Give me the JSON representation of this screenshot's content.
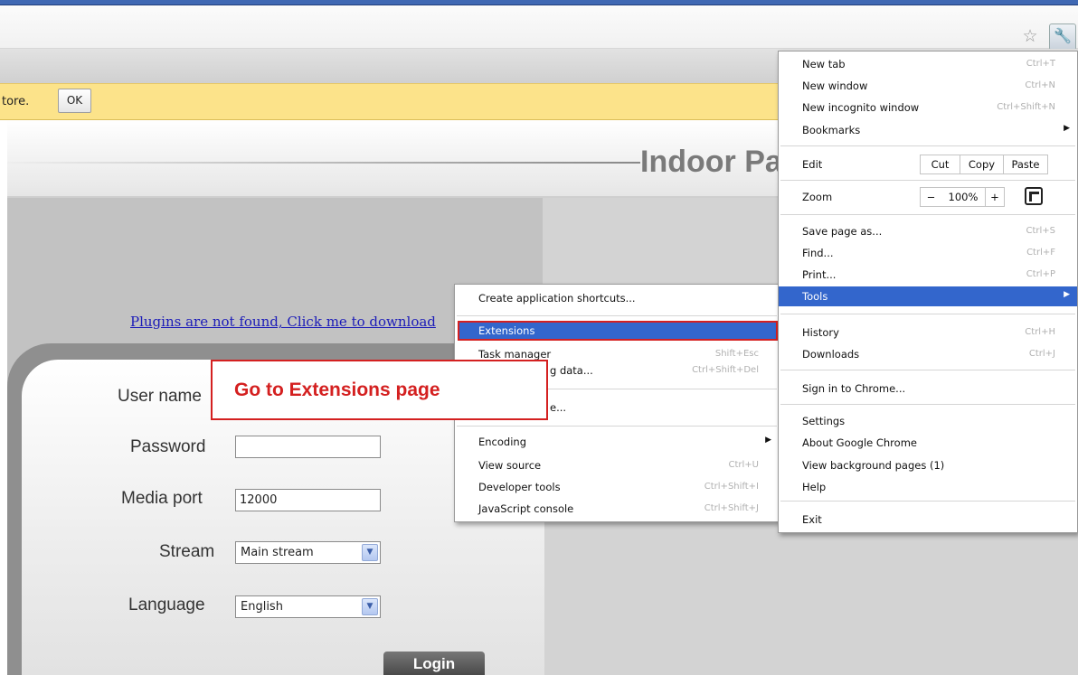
{
  "infobar": {
    "text": "tore.",
    "ok_label": "OK"
  },
  "toolbar": {
    "star_icon": "star-icon",
    "wrench_icon": "wrench-icon"
  },
  "page": {
    "title": "Indoor Pa",
    "plugin_link": "Plugins are not found, Click me to download",
    "login": {
      "username_label": "User name",
      "password_label": "Password",
      "password_value": "",
      "mediaport_label": "Media port",
      "mediaport_value": "12000",
      "stream_label": "Stream",
      "stream_value": "Main stream",
      "language_label": "Language",
      "language_value": "English",
      "login_button": "Login"
    }
  },
  "annotation": {
    "text": "Go to Extensions page"
  },
  "chrome_menu": {
    "new_tab": {
      "label": "New tab",
      "shortcut": "Ctrl+T"
    },
    "new_window": {
      "label": "New window",
      "shortcut": "Ctrl+N"
    },
    "new_incognito": {
      "label": "New incognito window",
      "shortcut": "Ctrl+Shift+N"
    },
    "bookmarks": {
      "label": "Bookmarks"
    },
    "edit": {
      "label": "Edit",
      "cut": "Cut",
      "copy": "Copy",
      "paste": "Paste"
    },
    "zoom": {
      "label": "Zoom",
      "minus": "−",
      "level": "100%",
      "plus": "+"
    },
    "save_page": {
      "label": "Save page as...",
      "shortcut": "Ctrl+S"
    },
    "find": {
      "label": "Find...",
      "shortcut": "Ctrl+F"
    },
    "print": {
      "label": "Print...",
      "shortcut": "Ctrl+P"
    },
    "tools": {
      "label": "Tools"
    },
    "history": {
      "label": "History",
      "shortcut": "Ctrl+H"
    },
    "downloads": {
      "label": "Downloads",
      "shortcut": "Ctrl+J"
    },
    "sign_in": {
      "label": "Sign in to Chrome..."
    },
    "settings": {
      "label": "Settings"
    },
    "about": {
      "label": "About Google Chrome"
    },
    "background_pages": {
      "label": "View background pages (1)"
    },
    "help": {
      "label": "Help"
    },
    "exit": {
      "label": "Exit"
    }
  },
  "tools_submenu": {
    "create_shortcuts": {
      "label": "Create application shortcuts..."
    },
    "extensions": {
      "label": "Extensions"
    },
    "task_manager": {
      "label": "Task manager",
      "shortcut": "Shift+Esc"
    },
    "clear_browsing": {
      "label": "g data...",
      "shortcut": "Ctrl+Shift+Del"
    },
    "report_issue": {
      "label": "e..."
    },
    "encoding": {
      "label": "Encoding"
    },
    "view_source": {
      "label": "View source",
      "shortcut": "Ctrl+U"
    },
    "developer_tools": {
      "label": "Developer tools",
      "shortcut": "Ctrl+Shift+I"
    },
    "js_console": {
      "label": "JavaScript console",
      "shortcut": "Ctrl+Shift+J"
    }
  },
  "colors": {
    "highlight": "#3366cc",
    "annotation_red": "#d42020",
    "infobar": "#fce38a"
  }
}
